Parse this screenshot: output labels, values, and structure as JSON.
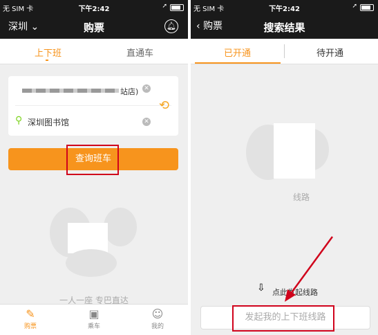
{
  "status": {
    "carrier": "无 SIM 卡",
    "time": "下午2:42"
  },
  "left": {
    "city": "深圳",
    "nav_title": "购票",
    "tabs": [
      "上下班",
      "直通车"
    ],
    "origin_suffix": "站店)",
    "destination": "深圳图书馆",
    "query_button": "查询班车",
    "slogan": "一人一座 专巴直达",
    "bottom_nav": [
      "购票",
      "乘车",
      "我的"
    ]
  },
  "right": {
    "back_label": "购票",
    "nav_title": "搜索结果",
    "tabs": [
      "已开通",
      "待开通"
    ],
    "empty_text": "线路",
    "hint": "点此发起线路",
    "launch_button": "发起我的上下班线路"
  },
  "colors": {
    "accent": "#f7941d",
    "highlight": "#d0021b",
    "bar": "#1a1a1a"
  }
}
